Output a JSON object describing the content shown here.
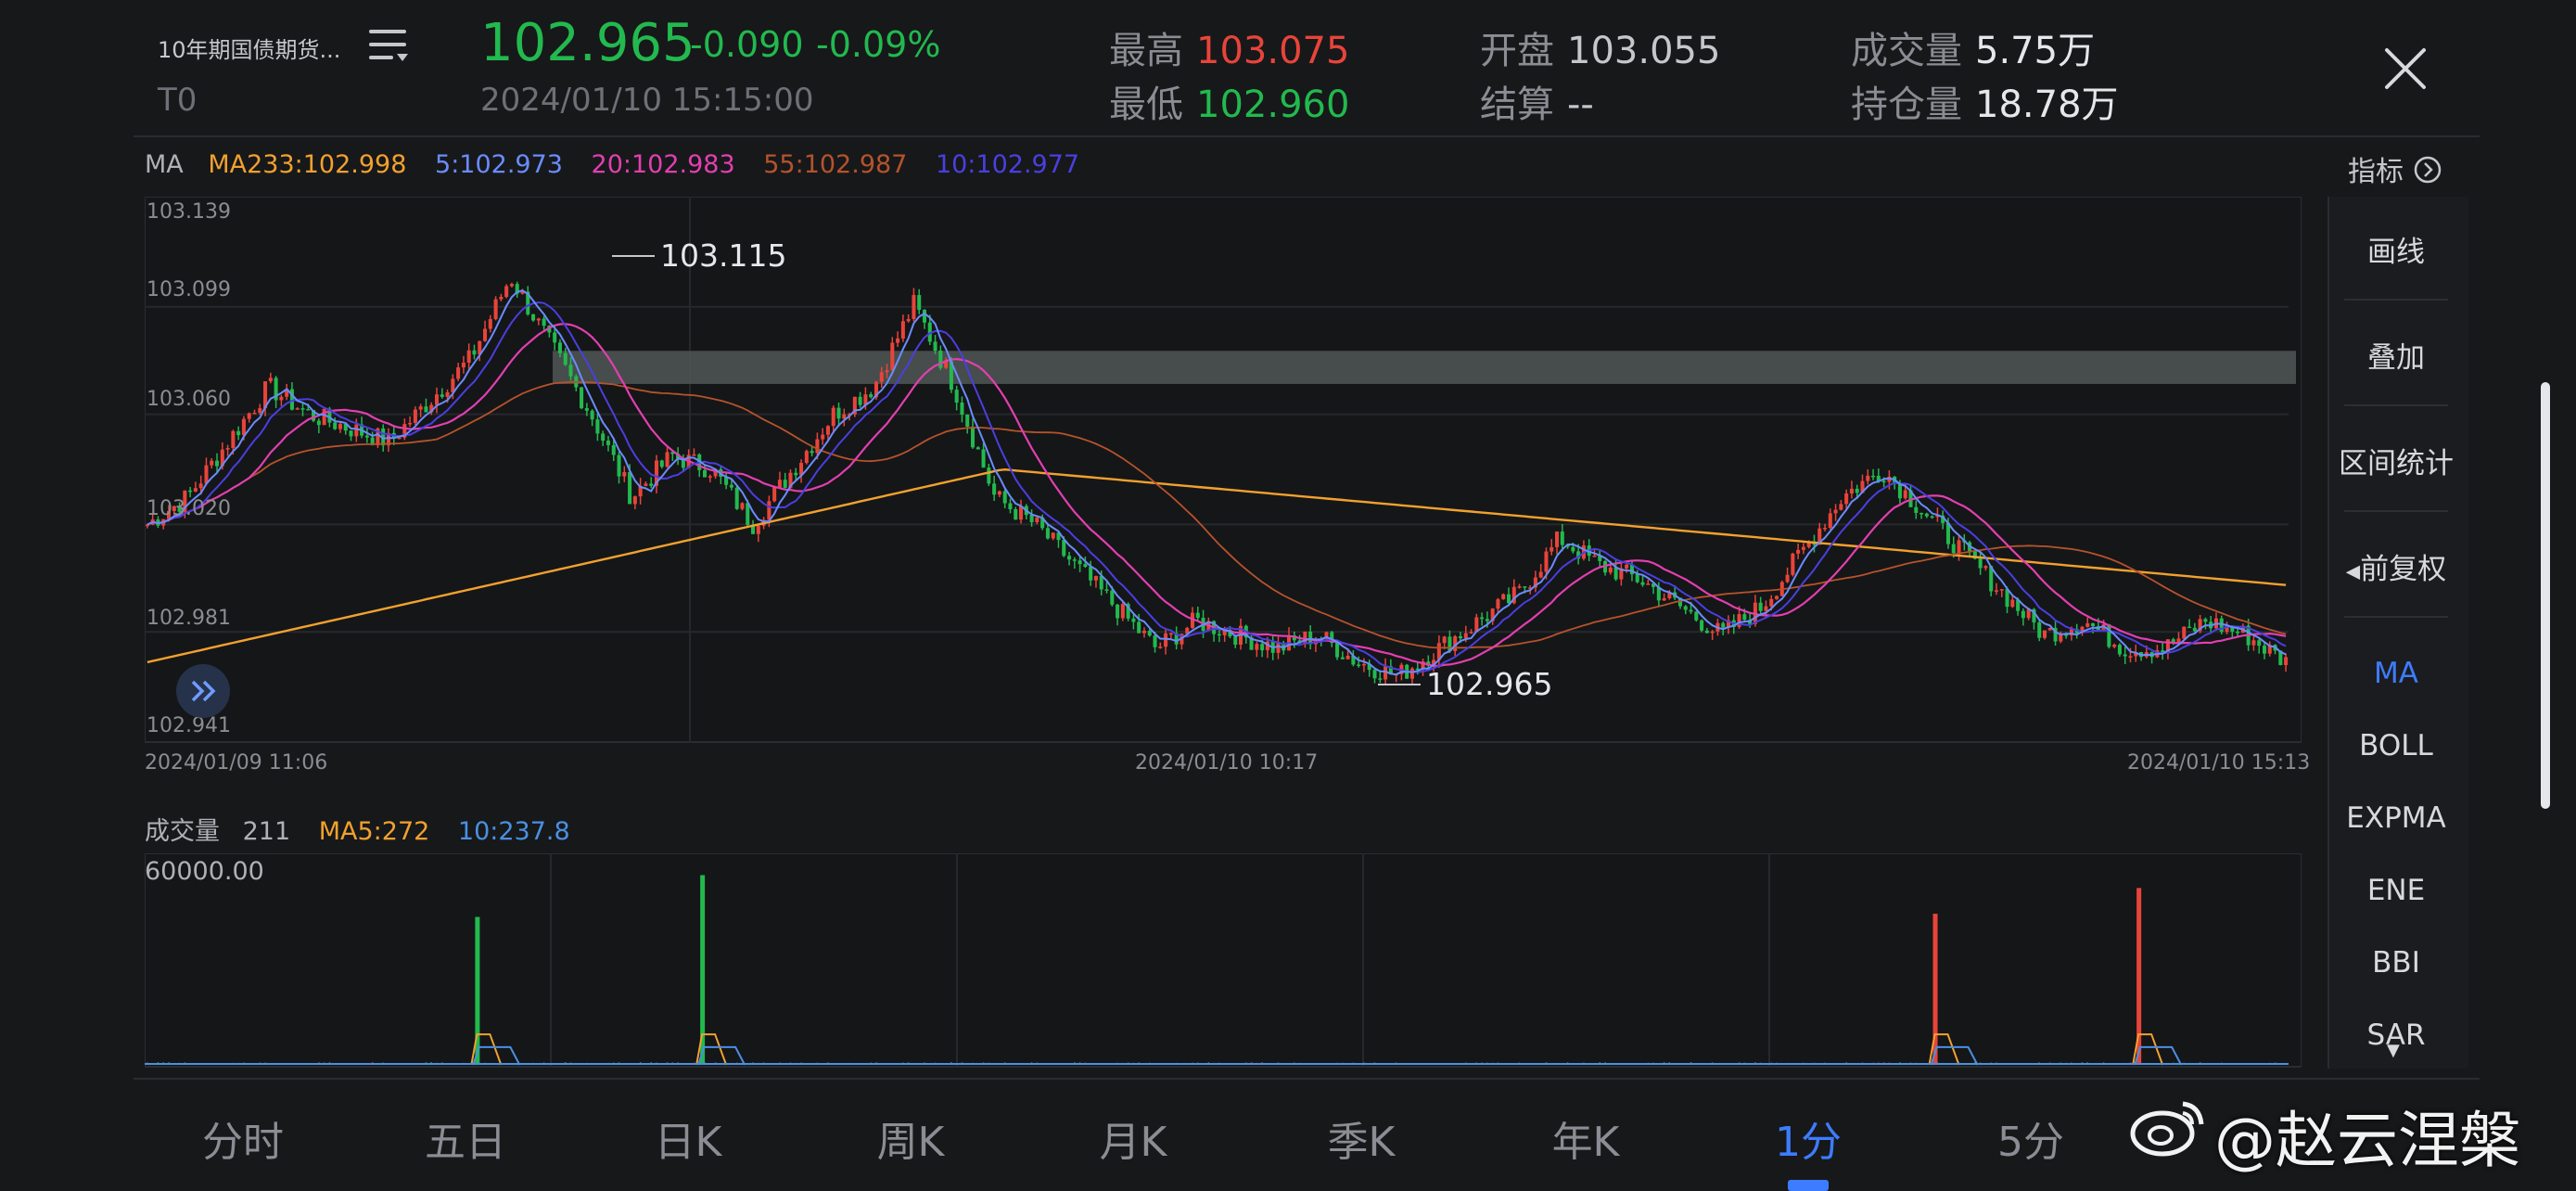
{
  "header": {
    "contract_name": "10年期国债期货...",
    "contract_code": "T0",
    "price": "102.965",
    "change": "-0.090",
    "change_pct": "-0.09%",
    "datetime": "2024/01/10 15:15:00",
    "high_label": "最高",
    "high_value": "103.075",
    "low_label": "最低",
    "low_value": "102.960",
    "open_label": "开盘",
    "open_value": "103.055",
    "settle_label": "结算",
    "settle_value": "--",
    "volume_label": "成交量",
    "volume_value": "5.75万",
    "oi_label": "持仓量",
    "oi_value": "18.78万"
  },
  "ma_bar": {
    "title": "MA",
    "ma233": "MA233:102.998",
    "ma5": "5:102.973",
    "ma20": "20:102.983",
    "ma55": "55:102.987",
    "ma10": "10:102.977",
    "indicator_btn": "指标"
  },
  "price_axis": [
    "103.139",
    "103.099",
    "103.060",
    "103.020",
    "102.981",
    "102.941"
  ],
  "time_axis": [
    "2024/01/09 11:06",
    "2024/01/10 10:17",
    "2024/01/10 15:13"
  ],
  "annotations": {
    "high_mark": "103.115",
    "low_mark": "102.965"
  },
  "volume_bar": {
    "title": "成交量",
    "value": "211",
    "ma5": "MA5:272",
    "ma10": "10:237.8",
    "axis_max": "60000.00"
  },
  "side_menu": [
    "画线",
    "叠加",
    "区间统计",
    "前复权"
  ],
  "indicators": [
    "MA",
    "BOLL",
    "EXPMA",
    "ENE",
    "BBI",
    "SAR"
  ],
  "tabs": [
    "分时",
    "五日",
    "日K",
    "周K",
    "月K",
    "季K",
    "年K",
    "1分",
    "5分"
  ],
  "active_tab": "1分",
  "watermark": "@赵云涅槃",
  "colors": {
    "up": "#e8443a",
    "down": "#22b94e",
    "ma5": "#6a8cff",
    "ma10": "#4a3fe0",
    "ma20": "#e23fb0",
    "ma55": "#b5532c",
    "ma233": "#f2a12e",
    "active": "#3d7cff"
  },
  "chart_data": {
    "type": "candlestick",
    "title": "",
    "ylim": [
      102.941,
      103.139
    ],
    "x_start": "2024/01/09 11:06",
    "x_end": "2024/01/10 15:13",
    "marked_high": 103.115,
    "marked_low": 102.965,
    "ma_values": {
      "MA233": 102.998,
      "MA5": 102.973,
      "MA20": 102.983,
      "MA55": 102.987,
      "MA10": 102.977
    },
    "price_path_keypoints": [
      103.02,
      103.03,
      103.05,
      103.07,
      103.06,
      103.055,
      103.05,
      103.065,
      103.08,
      103.11,
      103.085,
      103.06,
      103.03,
      103.045,
      103.04,
      103.02,
      103.04,
      103.06,
      103.07,
      103.1,
      103.07,
      103.03,
      103.02,
      103.005,
      102.99,
      102.975,
      102.985,
      102.98,
      102.975,
      102.98,
      102.97,
      102.965,
      102.975,
      102.985,
      102.995,
      103.015,
      103.005,
      103.0,
      102.99,
      102.98,
      102.99,
      103.01,
      103.03,
      103.04,
      103.025,
      103.01,
      102.995,
      102.98,
      102.985,
      102.975,
      102.975,
      102.985,
      102.98,
      102.97
    ],
    "volume_spikes": [
      {
        "time_index": 0.155,
        "value": 46000,
        "dir": "down"
      },
      {
        "time_index": 0.26,
        "value": 59000,
        "dir": "down"
      },
      {
        "time_index": 0.835,
        "value": 47000,
        "dir": "up"
      },
      {
        "time_index": 0.93,
        "value": 55000,
        "dir": "up"
      }
    ]
  }
}
